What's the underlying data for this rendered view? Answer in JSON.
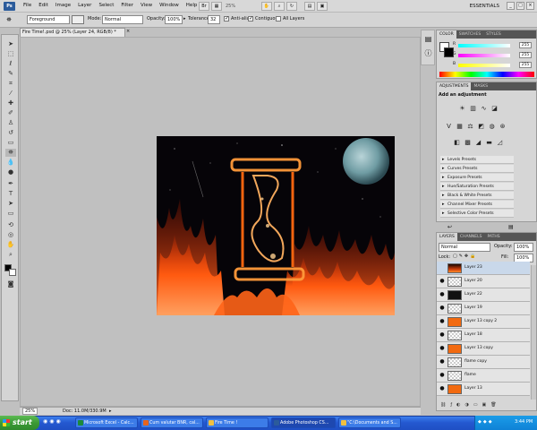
{
  "app": {
    "logo_text": "Ps",
    "menu": [
      "File",
      "Edit",
      "Image",
      "Layer",
      "Select",
      "Filter",
      "View",
      "Window",
      "Help"
    ],
    "zoom_display": "25%",
    "workspace": "ESSENTIALS"
  },
  "options_bar": {
    "source_value": "Foreground",
    "mode_label": "Mode:",
    "mode_value": "Normal",
    "opacity_label": "Opacity:",
    "opacity_value": "100%",
    "tolerance_label": "Tolerance:",
    "tolerance_value": "32",
    "antialias_label": "Anti-alias",
    "contiguous_label": "Contiguous",
    "all_layers_label": "All Layers",
    "antialias_checked": true,
    "contiguous_checked": true,
    "all_layers_checked": false
  },
  "document": {
    "tab_title": "Fire Time!.psd @ 25% (Layer 24, RGB/8) *",
    "status_zoom": "25%",
    "status_doc": "Doc: 11.0M/330.9M"
  },
  "color_panel": {
    "tabs": [
      "COLOR",
      "SWATCHES",
      "STYLES"
    ],
    "channels": [
      {
        "label": "R",
        "value": "255",
        "color": "#19d6e6"
      },
      {
        "label": "G",
        "value": "255",
        "color": "#e048c8"
      },
      {
        "label": "B",
        "value": "255",
        "color": "#e8d820"
      }
    ]
  },
  "adjustments_panel": {
    "tabs": [
      "ADJUSTMENTS",
      "MASKS"
    ],
    "heading": "Add an adjustment",
    "presets": [
      "Levels Presets",
      "Curves Presets",
      "Exposure Presets",
      "Hue/Saturation Presets",
      "Black & White Presets",
      "Channel Mixer Presets",
      "Selective Color Presets"
    ]
  },
  "layers_panel": {
    "tabs": [
      "LAYERS",
      "CHANNELS",
      "PATHS"
    ],
    "blend_mode": "Normal",
    "opacity_label": "Opacity:",
    "opacity_value": "100%",
    "lock_label": "Lock:",
    "fill_label": "Fill:",
    "fill_value": "100%",
    "layers": [
      {
        "name": "Layer 23"
      },
      {
        "name": "Layer 20"
      },
      {
        "name": "Layer 22"
      },
      {
        "name": "Layer 19"
      },
      {
        "name": "Layer 13 copy 2"
      },
      {
        "name": "Layer 18"
      },
      {
        "name": "Layer 13 copy"
      },
      {
        "name": "flame copy"
      },
      {
        "name": "flame"
      },
      {
        "name": "Layer 13"
      }
    ]
  },
  "taskbar": {
    "start_label": "start",
    "tasks": [
      {
        "label": "Microsoft Excel - Calc..."
      },
      {
        "label": "Cum valutar BNR, cal..."
      },
      {
        "label": "Fire Time !"
      },
      {
        "label": "Adobe Photoshop CS..."
      },
      {
        "label": "\"C:\\Documents and S..."
      }
    ],
    "clock": "3:44 PM"
  }
}
